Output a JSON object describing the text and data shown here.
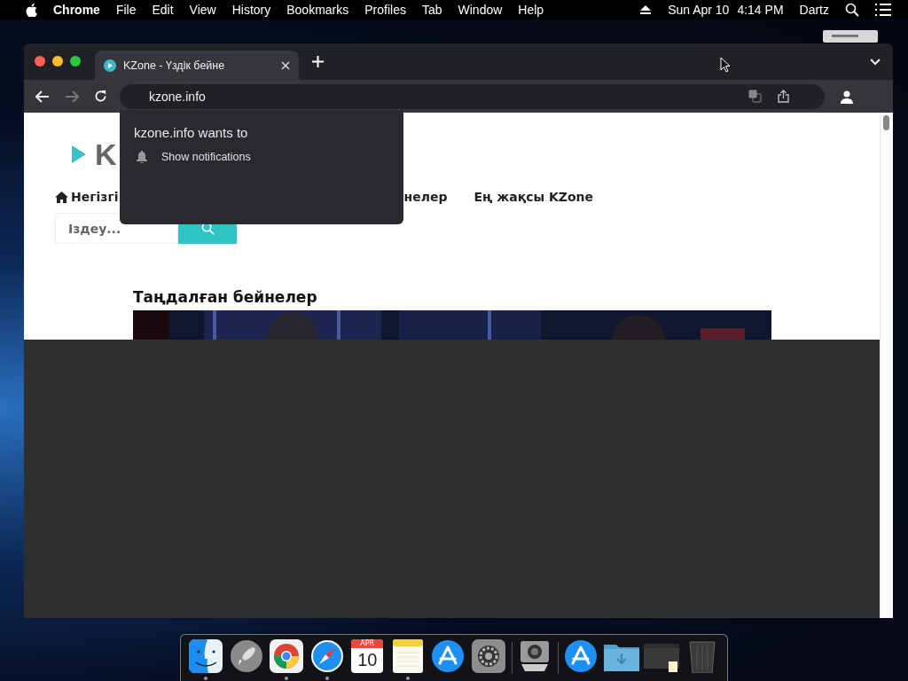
{
  "menubar": {
    "app": "Chrome",
    "menus": [
      "File",
      "Edit",
      "View",
      "History",
      "Bookmarks",
      "Profiles",
      "Tab",
      "Window",
      "Help"
    ],
    "date": "Sun Apr 10",
    "time": "4:14 PM",
    "user": "Dartz"
  },
  "browser": {
    "tabs": [
      {
        "title": "KZone - Үздік бейне",
        "selected": true
      }
    ],
    "address": "kzone.info",
    "page": {
      "logo": "K",
      "nav": [
        {
          "label": "Негізгі",
          "kind": "home"
        },
        {
          "label": "нелер",
          "kind": "text"
        },
        {
          "label": "Ең жақсы KZone",
          "kind": "text"
        }
      ],
      "search_placeholder": "Іздеу...",
      "section_title": "Таңдалған бейнелер"
    }
  },
  "permission_popup": {
    "title": "kzone.info wants to",
    "items": [
      "Show notifications"
    ]
  },
  "dock": {
    "apps": [
      {
        "kind": "finder",
        "running": true
      },
      {
        "kind": "launchpad",
        "running": false
      },
      {
        "kind": "chrome",
        "running": true
      },
      {
        "kind": "safari",
        "running": true
      },
      {
        "kind": "calendar",
        "running": false,
        "month": "APR",
        "day": "10"
      },
      {
        "kind": "notes",
        "running": true
      },
      {
        "kind": "appstore",
        "running": false
      },
      {
        "kind": "settings",
        "running": false
      },
      {
        "kind": "separator"
      },
      {
        "kind": "screenshot",
        "running": false
      },
      {
        "kind": "separator"
      },
      {
        "kind": "appstore",
        "running": false
      },
      {
        "kind": "downloads",
        "running": false
      },
      {
        "kind": "folder",
        "running": false
      },
      {
        "kind": "trash",
        "running": false
      }
    ]
  }
}
